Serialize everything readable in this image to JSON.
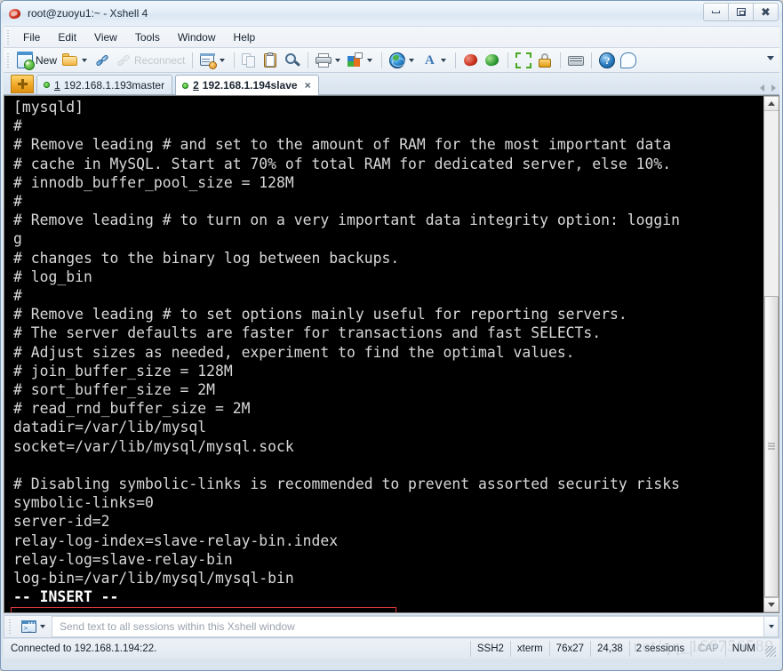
{
  "window": {
    "title": "root@zuoyu1:~ - Xshell 4",
    "icon": "xshell-logo-icon",
    "minimize_label": "",
    "maximize_label": "",
    "close_label": "✖"
  },
  "menubar": {
    "items": [
      {
        "label": "File"
      },
      {
        "label": "Edit"
      },
      {
        "label": "View"
      },
      {
        "label": "Tools"
      },
      {
        "label": "Window"
      },
      {
        "label": "Help"
      }
    ]
  },
  "toolbar": {
    "new_label": "New",
    "reconnect_label": "Reconnect",
    "items": [
      {
        "name": "new-session-button",
        "icon": "new-window-icon",
        "label": "New"
      },
      {
        "name": "open-session-button",
        "icon": "open-folder-icon",
        "label": ""
      },
      {
        "name": "connect-button",
        "icon": "plug-connect-icon",
        "label": ""
      },
      {
        "name": "reconnect-button",
        "icon": "reconnect-icon",
        "label": "Reconnect"
      },
      {
        "name": "session-properties-button",
        "icon": "window-gear-icon",
        "label": ""
      },
      {
        "name": "copy-button",
        "icon": "copy-icon",
        "label": ""
      },
      {
        "name": "paste-button",
        "icon": "paste-icon",
        "label": ""
      },
      {
        "name": "find-button",
        "icon": "magnifier-icon",
        "label": ""
      },
      {
        "name": "print-button",
        "icon": "printer-icon",
        "label": ""
      },
      {
        "name": "transfer-button",
        "icon": "color-transfer-icon",
        "label": ""
      },
      {
        "name": "encoding-button",
        "icon": "globe-icon",
        "label": ""
      },
      {
        "name": "font-button",
        "icon": "font-a-icon",
        "label": ""
      },
      {
        "name": "xshell-button",
        "icon": "xshell-icon",
        "label": ""
      },
      {
        "name": "xftp-button",
        "icon": "xftp-icon",
        "label": ""
      },
      {
        "name": "fullscreen-button",
        "icon": "fullscreen-icon",
        "label": ""
      },
      {
        "name": "lock-button",
        "icon": "lock-icon",
        "label": ""
      },
      {
        "name": "keyboard-button",
        "icon": "keyboard-icon",
        "label": ""
      },
      {
        "name": "help-button",
        "icon": "help-icon",
        "label": "?"
      },
      {
        "name": "chat-button",
        "icon": "chat-bubble-icon",
        "label": ""
      }
    ]
  },
  "tabs": [
    {
      "number": "1",
      "label": "192.168.1.193master",
      "active": false,
      "status": "connected"
    },
    {
      "number": "2",
      "label": "192.168.1.194slave",
      "active": true,
      "status": "connected",
      "close": "×"
    }
  ],
  "terminal": {
    "lines": [
      "[mysqld]",
      "#",
      "# Remove leading # and set to the amount of RAM for the most important data",
      "# cache in MySQL. Start at 70% of total RAM for dedicated server, else 10%.",
      "# innodb_buffer_pool_size = 128M",
      "#",
      "# Remove leading # to turn on a very important data integrity option: loggin",
      "g",
      "# changes to the binary log between backups.",
      "# log_bin",
      "#",
      "# Remove leading # to set options mainly useful for reporting servers.",
      "# The server defaults are faster for transactions and fast SELECTs.",
      "# Adjust sizes as needed, experiment to find the optimal values.",
      "# join_buffer_size = 128M",
      "# sort_buffer_size = 2M",
      "# read_rnd_buffer_size = 2M",
      "datadir=/var/lib/mysql",
      "socket=/var/lib/mysql/mysql.sock",
      "",
      "# Disabling symbolic-links is recommended to prevent assorted security risks",
      "symbolic-links=0",
      "server-id=2",
      "relay-log-index=slave-relay-bin.index",
      "relay-log=slave-relay-bin",
      "log-bin=/var/lib/mysql/mysql-bin"
    ],
    "mode_line": "-- INSERT --",
    "annotation_color": "#e03a3a",
    "cursor_color": "#19d219",
    "background": "#000000",
    "foreground": "#d8d8d8"
  },
  "sendbar": {
    "icon": "session-window-icon",
    "placeholder": "Send text to all sessions within this Xshell window"
  },
  "statusbar": {
    "message": "Connected to 192.168.1.194:22.",
    "cells": [
      {
        "label": "SSH2"
      },
      {
        "label": "xterm"
      },
      {
        "label": "76x27"
      },
      {
        "label": "24,38"
      },
      {
        "label": "2 sessions"
      },
      {
        "label": "CAP",
        "dim": true
      },
      {
        "label": "NUM",
        "dim": false
      }
    ],
    "watermark": "net/qq_166756589"
  }
}
